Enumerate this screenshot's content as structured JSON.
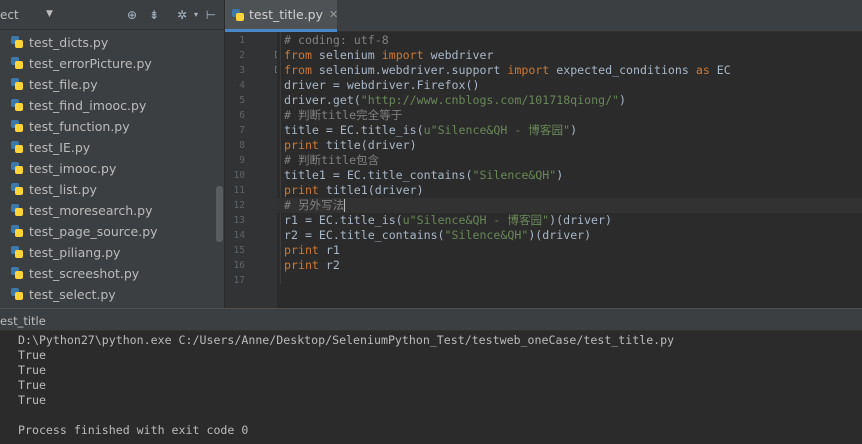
{
  "project_panel": {
    "title": "ect",
    "toolbar_icons": [
      "target-icon",
      "collapse-icon",
      "gear-icon",
      "pin-icon"
    ],
    "files": [
      "test_dicts.py",
      "test_errorPicture.py",
      "test_file.py",
      "test_find_imooc.py",
      "test_function.py",
      "test_IE.py",
      "test_imooc.py",
      "test_list.py",
      "test_moresearch.py",
      "test_page_source.py",
      "test_piliang.py",
      "test_screeshot.py",
      "test_select.py"
    ]
  },
  "editor": {
    "tab_label": "test_title.py",
    "line_numbers": [
      "1",
      "2",
      "3",
      "4",
      "5",
      "6",
      "7",
      "8",
      "9",
      "10",
      "11",
      "12",
      "13",
      "14",
      "15",
      "16",
      "17"
    ],
    "code": {
      "l1": "# coding: utf-8",
      "l2_kw1": "from",
      "l2_mid": " selenium ",
      "l2_kw2": "import",
      "l2_end": " webdriver",
      "l3_kw1": "from",
      "l3_mid": " selenium.webdriver.support ",
      "l3_kw2": "import",
      "l3_mid2": " expected_conditions ",
      "l3_kw3": "as",
      "l3_end": " EC",
      "l4": "driver = webdriver.Firefox()",
      "l5_a": "driver.get(",
      "l5_str": "\"http://www.cnblogs.com/101718qiong/\"",
      "l5_b": ")",
      "l6": "# 判断title完全等于",
      "l7_a": "title = EC.title_is(",
      "l7_str": "u\"Silence&QH - 博客园\"",
      "l7_b": ")",
      "l8_kw": "print",
      "l8_b": " title(driver)",
      "l9": "# 判断title包含",
      "l10_a": "title1 = EC.title_contains(",
      "l10_str": "\"Silence&QH\"",
      "l10_b": ")",
      "l11_kw": "print",
      "l11_b": " title1(driver)",
      "l12": "# 另外写法",
      "l13_a": "r1 = EC.title_is(",
      "l13_str": "u\"Silence&QH - 博客园\"",
      "l13_b": ")(driver)",
      "l14_a": "r2 = EC.title_contains(",
      "l14_str": "\"Silence&QH\"",
      "l14_b": ")(driver)",
      "l15_kw": "print",
      "l15_b": " r1",
      "l16_kw": "print",
      "l16_b": " r2"
    }
  },
  "run_panel": {
    "label": "est_title",
    "output": [
      "D:\\Python27\\python.exe C:/Users/Anne/Desktop/SeleniumPython_Test/testweb_oneCase/test_title.py",
      "True",
      "True",
      "True",
      "True",
      "",
      "Process finished with exit code 0"
    ]
  },
  "colors": {
    "keyword": "#cc7832",
    "string": "#6a8759",
    "comment": "#808080",
    "text": "#a9b7c6",
    "tab_underline": "#4a88c7"
  }
}
